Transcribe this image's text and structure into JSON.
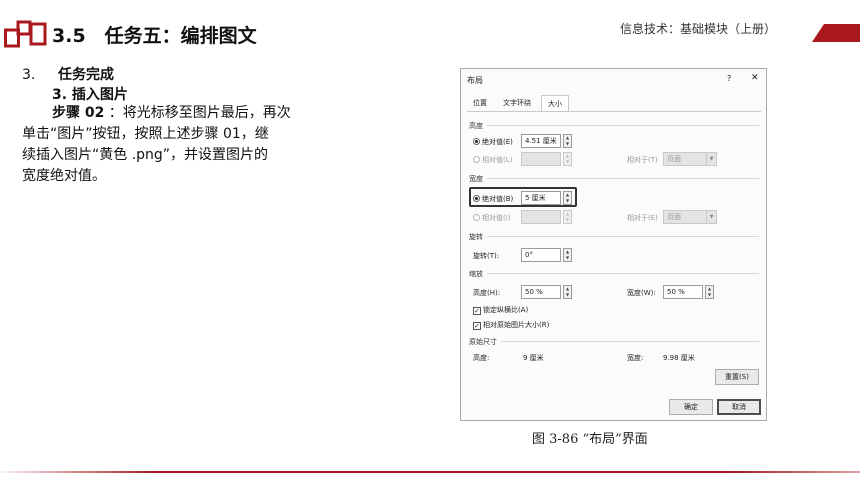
{
  "header": {
    "section_title": "3.5　任务五：编排图文",
    "book_title": "信息技术：基础模块（上册）",
    "accent_color": "#a8181c"
  },
  "content": {
    "heading_num": "3.",
    "heading_text": "任务完成",
    "subheading": "3. 插入图片",
    "step_label": "步骤 02",
    "para_line1": " ：将光标移至图片最后，再次",
    "para_line2": "单击“图片”按钮，按照上述步骤 01，继",
    "para_line3": "续插入图片“黄色 .png”，并设置图片的",
    "para_line4": "宽度绝对值。"
  },
  "dialog": {
    "title": "布局",
    "help": "?",
    "close": "✕",
    "tabs": [
      "位置",
      "文字环绕",
      "大小"
    ],
    "active_tab": 2,
    "height_group": {
      "label": "高度",
      "absolute_label": "绝对值(E)",
      "absolute_value": "4.51 厘米",
      "relative_label": "相对值(L)",
      "relative_to_label": "相对于(T)",
      "relative_to_value": "页面"
    },
    "width_group": {
      "label": "宽度",
      "absolute_label": "绝对值(B)",
      "absolute_value": "5 厘米",
      "relative_label": "相对值(I)",
      "relative_to_label": "相对于(E)",
      "relative_to_value": "页面"
    },
    "rotate_group": {
      "label": "旋转",
      "rotate_label": "旋转(T):",
      "rotate_value": "0°"
    },
    "scale_group": {
      "label": "缩放",
      "height_label": "高度(H):",
      "height_value": "50 %",
      "width_label": "宽度(W):",
      "width_value": "50 %",
      "lock_label": "锁定纵横比(A)",
      "relative_label": "相对原始图片大小(R)"
    },
    "original_group": {
      "label": "原始尺寸",
      "height_label": "高度:",
      "height_value": "9 厘米",
      "width_label": "宽度:",
      "width_value": "9.98 厘米"
    },
    "reset_label": "重置(S)",
    "ok_label": "确定",
    "cancel_label": "取消"
  },
  "caption": "图 3-86 “布局”界面"
}
